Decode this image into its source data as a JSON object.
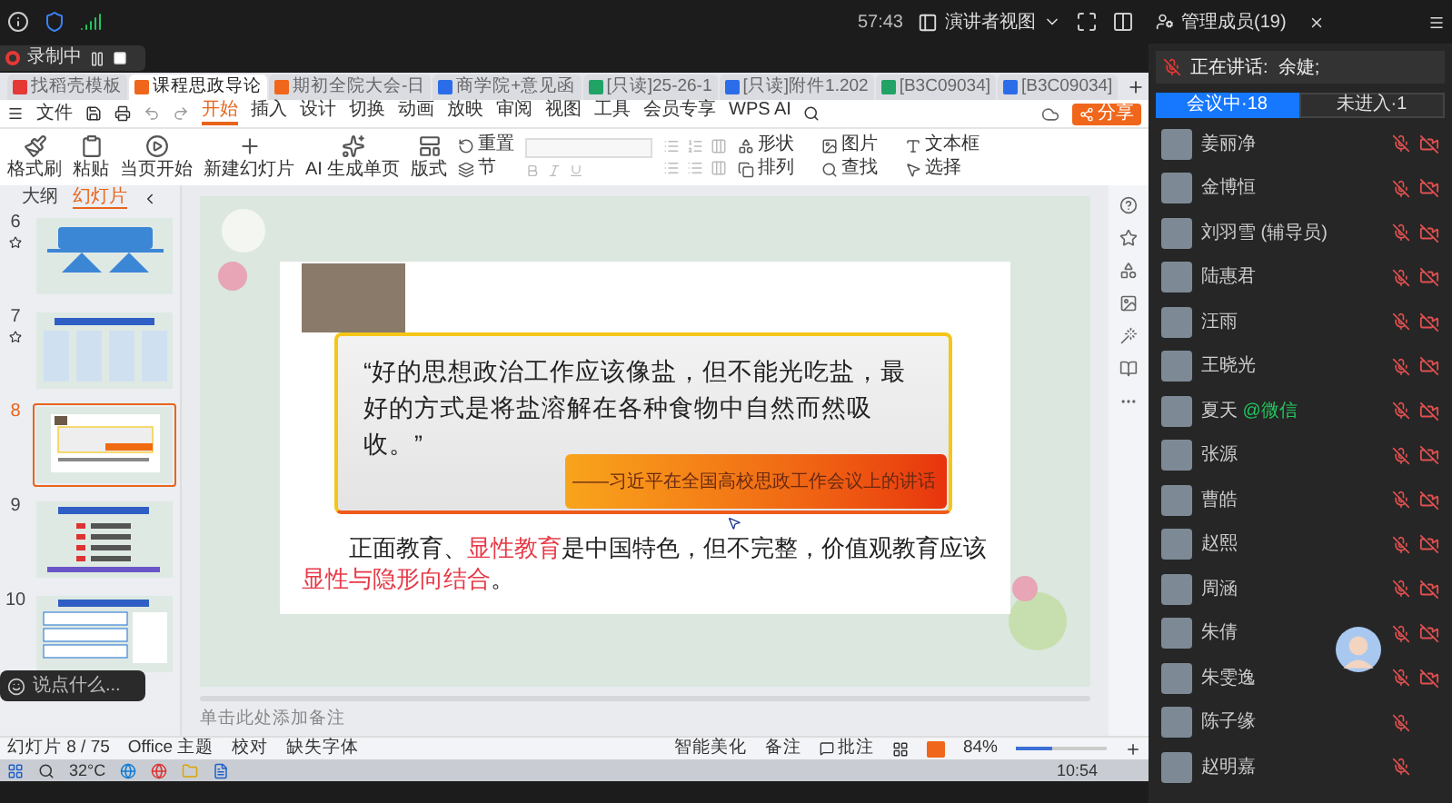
{
  "meeting_bar": {
    "timer": "57:43",
    "presenter_view": "演讲者视图",
    "members_title": "管理成员(19)"
  },
  "recording": {
    "label": "录制中"
  },
  "browser_tabs": [
    {
      "label": "找稻壳模板",
      "kind": "wps",
      "selected": false
    },
    {
      "label": "课程思政导论",
      "kind": "ppt",
      "selected": true
    },
    {
      "label": "期初全院大会-日",
      "kind": "ppt",
      "selected": false
    },
    {
      "label": "商学院+意见函",
      "kind": "doc",
      "selected": false
    },
    {
      "label": "[只读]25-26-1",
      "kind": "sheet",
      "selected": false
    },
    {
      "label": "[只读]附件1.202",
      "kind": "doc",
      "selected": false
    },
    {
      "label": "[B3C09034]",
      "kind": "sheet",
      "selected": false
    },
    {
      "label": "[B3C09034]",
      "kind": "doc",
      "selected": false
    }
  ],
  "menu": {
    "file": "文件",
    "tabs": [
      {
        "label": "开始",
        "selected": true
      },
      {
        "label": "插入",
        "selected": false
      },
      {
        "label": "设计",
        "selected": false
      },
      {
        "label": "切换",
        "selected": false
      },
      {
        "label": "动画",
        "selected": false
      },
      {
        "label": "放映",
        "selected": false
      },
      {
        "label": "审阅",
        "selected": false
      },
      {
        "label": "视图",
        "selected": false
      },
      {
        "label": "工具",
        "selected": false
      },
      {
        "label": "会员专享",
        "selected": false
      },
      {
        "label": "WPS AI",
        "selected": false
      }
    ],
    "share": "分享"
  },
  "ribbon": [
    {
      "label": "格式刷",
      "kind": "brush"
    },
    {
      "label": "粘贴",
      "kind": "paste"
    },
    {
      "label": "当页开始",
      "kind": "play"
    },
    {
      "label": "新建幻灯片",
      "kind": "new"
    },
    {
      "label": "AI 生成单页",
      "kind": "ai"
    },
    {
      "label": "版式",
      "kind": "layout"
    }
  ],
  "ribbon_small": [
    {
      "label": "重置",
      "kind": "reset"
    },
    {
      "label": "节",
      "kind": "section"
    }
  ],
  "ribbon_right": [
    {
      "label": "形状",
      "kind": "shapes"
    },
    {
      "label": "图片",
      "kind": "image"
    },
    {
      "label": "文本框",
      "kind": "text"
    },
    {
      "label": "排列",
      "kind": "arrange"
    },
    {
      "label": "查找",
      "kind": "find"
    },
    {
      "label": "选择",
      "kind": "select"
    }
  ],
  "outline": {
    "tabs": [
      {
        "label": "大纲",
        "selected": false
      },
      {
        "label": "幻灯片",
        "selected": true
      }
    ],
    "slides": [
      {
        "number": "6",
        "starred": true,
        "selected": false,
        "kind": "diagram"
      },
      {
        "number": "7",
        "starred": true,
        "selected": false,
        "kind": "columns"
      },
      {
        "number": "8",
        "starred": false,
        "selected": true,
        "kind": "quote"
      },
      {
        "number": "9",
        "starred": false,
        "selected": false,
        "kind": "list"
      },
      {
        "number": "10",
        "starred": false,
        "selected": false,
        "kind": "form"
      }
    ]
  },
  "comment_box": {
    "placeholder": "说点什么..."
  },
  "slide": {
    "quote": "“好的思想政治工作应该像盐，但不能光吃盐，最好的方式是将盐溶解在各种食物中自然而然吸收。”",
    "attribution": "——习近平在全国高校思政工作会议上的讲话",
    "body": [
      {
        "text": "正面教育、",
        "highlight": false
      },
      {
        "text": "显性教育",
        "highlight": true
      },
      {
        "text": "是中国特色，但不完整，价值观教育应该",
        "highlight": false
      },
      {
        "text": "显性与隐形向结合",
        "highlight": true
      },
      {
        "text": "。",
        "highlight": false
      }
    ]
  },
  "notes": {
    "placeholder": "单击此处添加备注"
  },
  "status_bar": {
    "left": [
      "幻灯片 8 / 75",
      "Office 主题",
      "校对",
      "缺失字体"
    ],
    "smart": "智能美化",
    "notes": "备注",
    "comments": "批注",
    "zoom": "84%",
    "zoom_slider": {
      "level": 0.4
    }
  },
  "taskbar": {
    "weather": "32°C",
    "time": "10:54"
  },
  "panel": {
    "speaking": "正在讲话:  余婕;",
    "tabs": [
      {
        "label": "会议中·18",
        "selected": true
      },
      {
        "label": "未进入·1",
        "selected": false
      }
    ],
    "members": [
      {
        "name": "姜丽净",
        "mic_muted": true,
        "camera": true
      },
      {
        "name": "金博恒",
        "mic_muted": true,
        "camera": true
      },
      {
        "name": "刘羽雪 (辅导员)",
        "mic_muted": true,
        "camera": true
      },
      {
        "name": "陆惠君",
        "mic_muted": true,
        "camera": true
      },
      {
        "name": "汪雨",
        "mic_muted": true,
        "camera": true
      },
      {
        "name": "王晓光",
        "mic_muted": true,
        "camera": true
      },
      {
        "name": "夏天",
        "tag": "@微信",
        "mic_muted": true,
        "camera": true
      },
      {
        "name": "张源",
        "mic_muted": true,
        "camera": true
      },
      {
        "name": "曹皓",
        "mic_muted": true,
        "camera": true
      },
      {
        "name": "赵熙",
        "mic_muted": true,
        "camera": true
      },
      {
        "name": "周涵",
        "mic_muted": true,
        "camera": true
      },
      {
        "name": "朱倩",
        "mic_muted": true,
        "camera": true
      },
      {
        "name": "朱雯逸",
        "mic_muted": true,
        "camera": true
      },
      {
        "name": "陈子缘",
        "mic_muted": true,
        "camera": false
      },
      {
        "name": "赵明嘉",
        "mic_muted": true,
        "camera": false
      }
    ]
  }
}
